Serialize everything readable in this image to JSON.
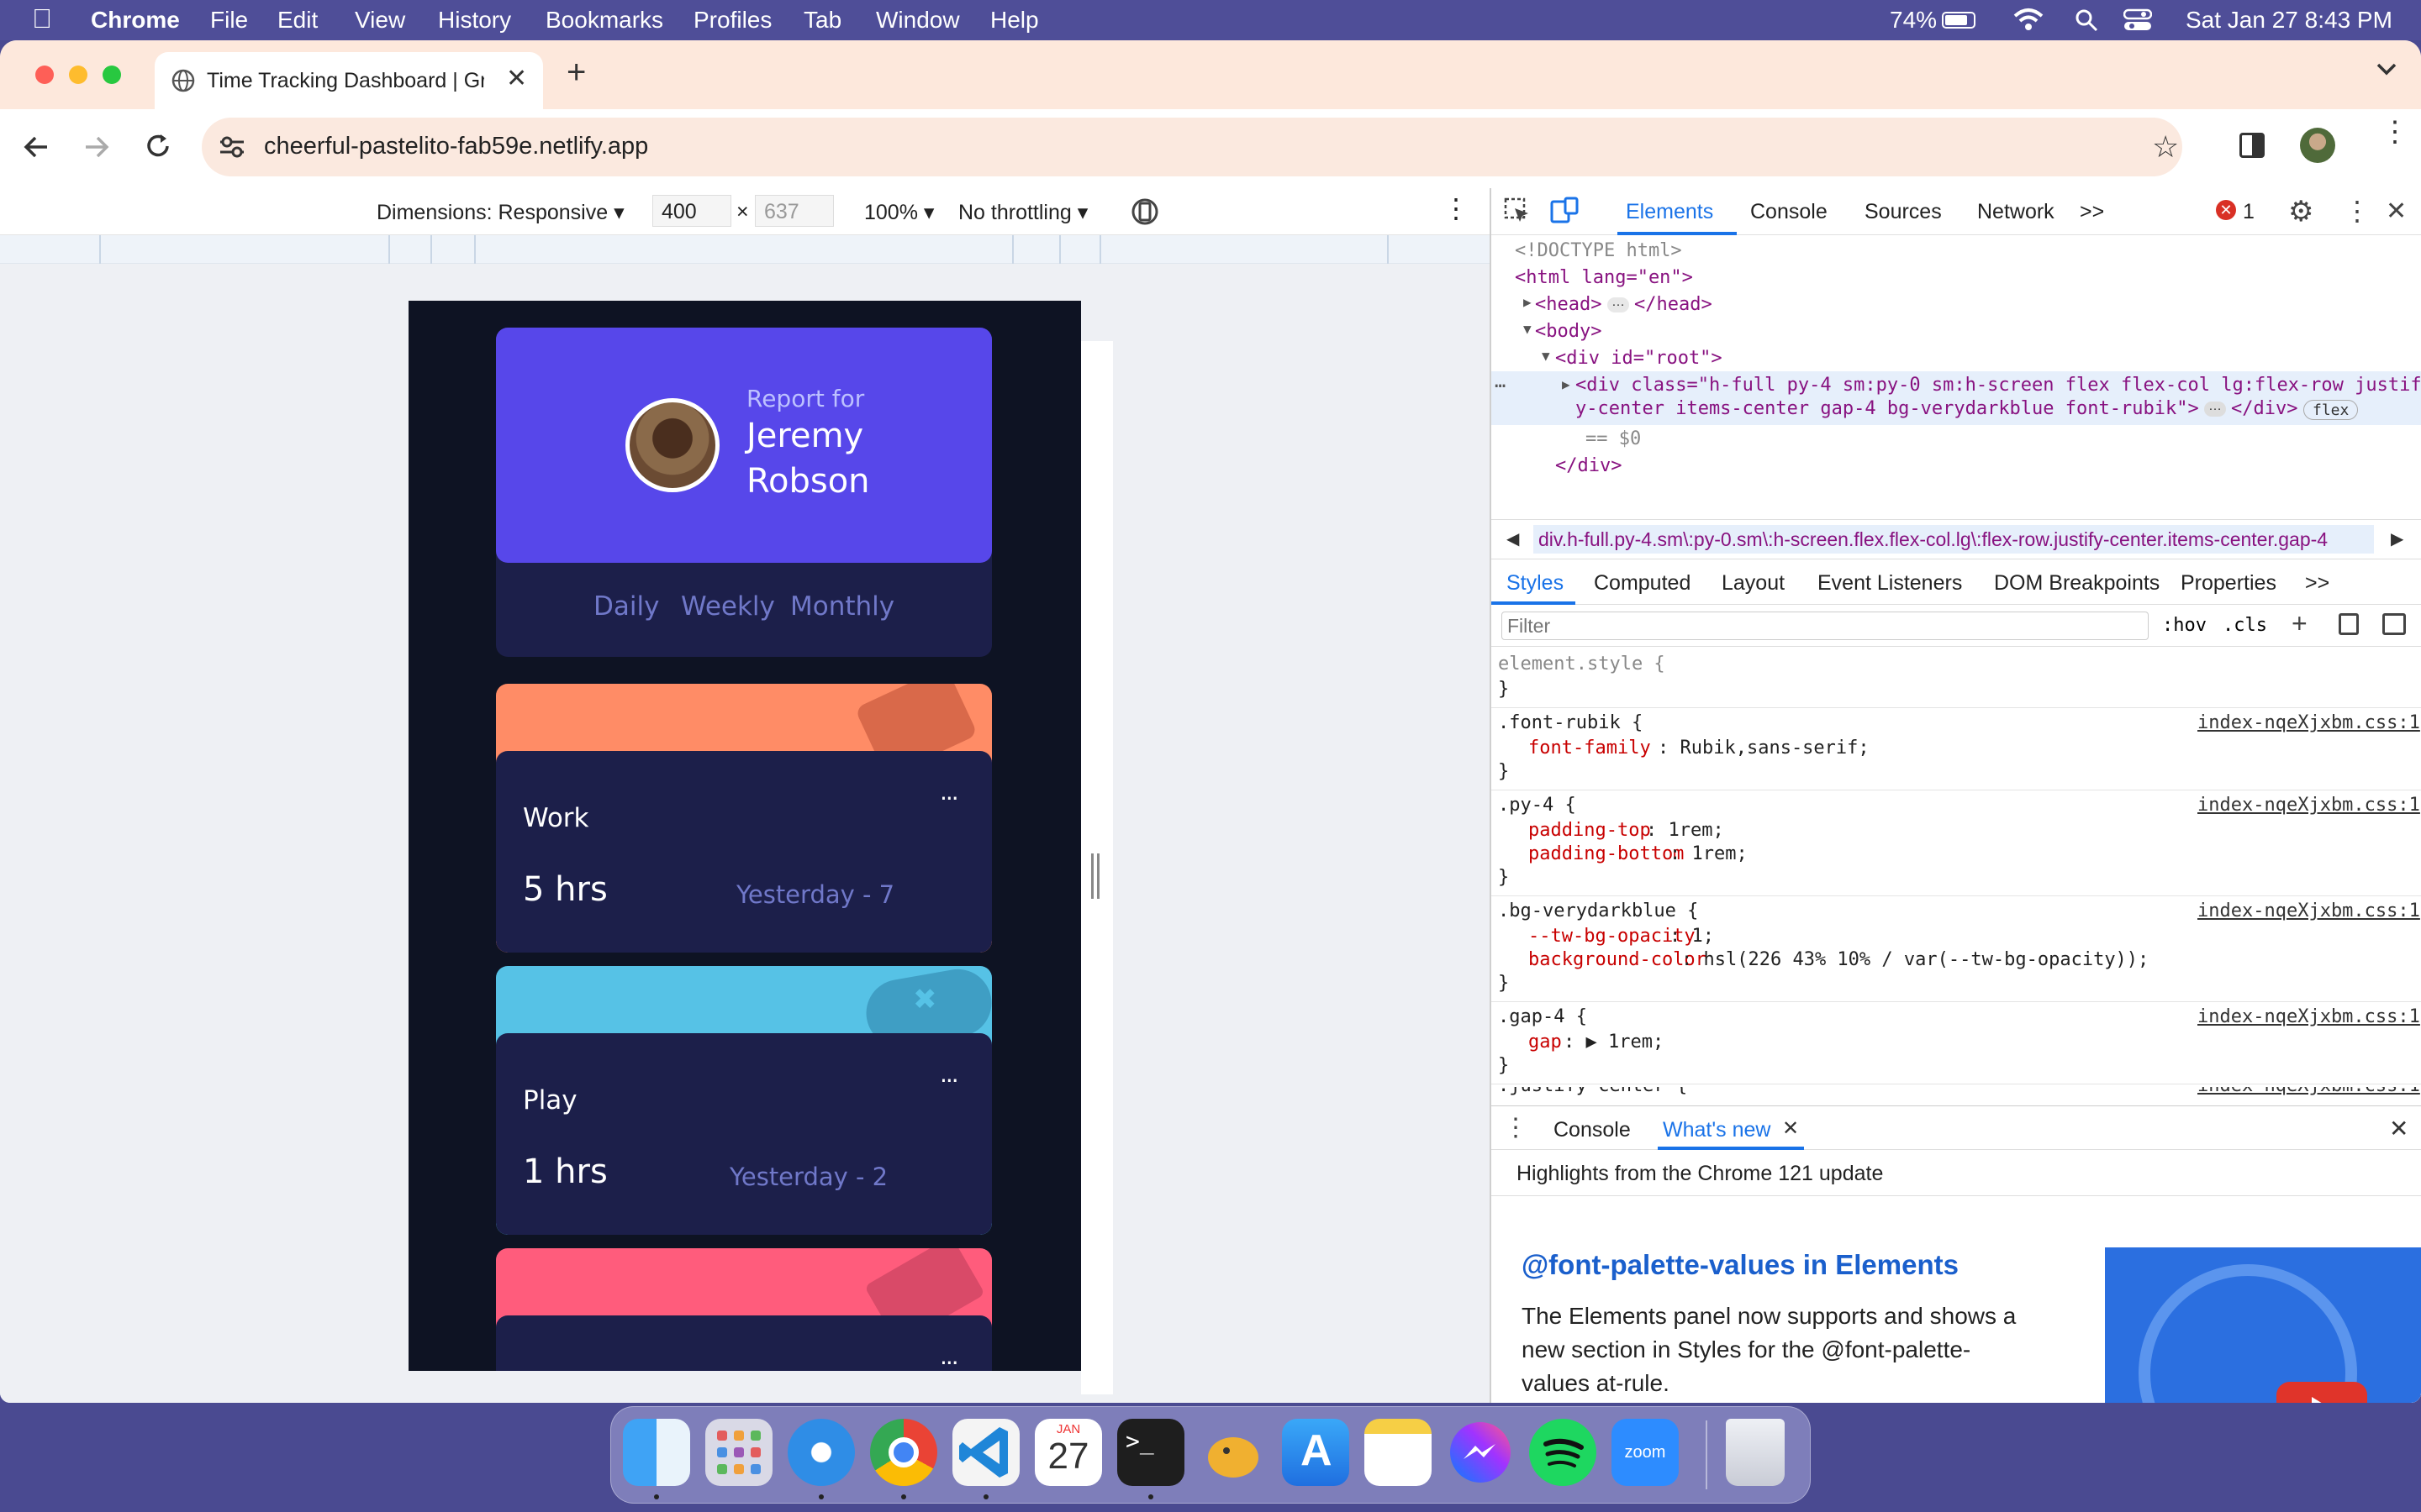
{
  "menubar": {
    "apple": "",
    "app_name": "Chrome",
    "items": [
      "File",
      "Edit",
      "View",
      "History",
      "Bookmarks",
      "Profiles",
      "Tab",
      "Window",
      "Help"
    ],
    "battery": "74%",
    "datetime": "Sat Jan 27  8:43 PM"
  },
  "browser": {
    "tab_title": "Time Tracking Dashboard | Gr",
    "new_tab": "+",
    "url": "cheerful-pastelito-fab59e.netlify.app"
  },
  "device_toolbar": {
    "dimensions_label": "Dimensions: Responsive",
    "width": "400",
    "times": "×",
    "height": "637",
    "zoom": "100%",
    "throttle": "No throttling"
  },
  "app": {
    "report_for": "Report for",
    "name_line1": "Jeremy",
    "name_line2": "Robson",
    "periods": [
      "Daily",
      "Weekly",
      "Monthly"
    ],
    "cards": [
      {
        "title": "Work",
        "hours": "5 hrs",
        "previous": "Yesterday - 7",
        "color": "#ff8c66"
      },
      {
        "title": "Play",
        "hours": "1 hrs",
        "previous": "Yesterday - 2",
        "color": "#56c2e6"
      },
      {
        "title": "",
        "hours": "",
        "previous": "",
        "color": "#ff5c7c"
      }
    ],
    "menu_dots": "···"
  },
  "devtools": {
    "tabs": [
      "Elements",
      "Console",
      "Sources",
      "Network"
    ],
    "more": ">>",
    "error_count": "1",
    "dom": {
      "doctype": "<!DOCTYPE html>",
      "html_open": "<html lang=\"en\">",
      "head": "<head>",
      "head_close": "</head>",
      "body": "<body>",
      "root": "<div id=\"root\">",
      "div_line1": "<div class=\"h-full py-4 sm:py-0 sm:h-screen flex flex-col lg:flex-row justif",
      "div_line2": "y-center items-center gap-4 bg-verydarkblue font-rubik\">",
      "div_close_inline": "</div>",
      "flex_badge": "flex",
      "eq0": "== $0",
      "div_close": "</div>"
    },
    "breadcrumb": "div.h-full.py-4.sm\\:py-0.sm\\:h-screen.flex.flex-col.lg\\:flex-row.justify-center.items-center.gap-4",
    "sub_tabs": [
      "Styles",
      "Computed",
      "Layout",
      "Event Listeners",
      "DOM Breakpoints",
      "Properties"
    ],
    "filter_placeholder": "Filter",
    "hov": ":hov",
    "cls": ".cls",
    "source": "index-nqeXjxbm.css:1",
    "rules": {
      "element_style": "element.style {",
      "close": "}",
      "font_rubik": ".font-rubik {",
      "font_family_prop": "font-family",
      "font_family_val": ": Rubik,sans-serif;",
      "py4": ".py-4 {",
      "pt_prop": "padding-top",
      "pt_val": ": 1rem;",
      "pb_prop": "padding-bottom",
      "pb_val": ": 1rem;",
      "bg": ".bg-verydarkblue {",
      "tw_prop": "--tw-bg-opacity",
      "tw_val": ": 1;",
      "bgc_prop": "background-color",
      "bgc_val": ": hsl(226 43% 10% / var(--tw-bg-opacity));",
      "gap": ".gap-4 {",
      "gap_prop": "gap",
      "gap_val": ": ▶ 1rem;",
      "justify": ".justify-center {"
    },
    "drawer_tabs": [
      "Console",
      "What's new"
    ],
    "highlights": "Highlights from the Chrome 121 update",
    "whats_new_title": "@font-palette-values in Elements",
    "whats_new_body": [
      "The Elements panel now supports and shows a",
      "new section in Styles for the @font-palette-",
      "values at-rule."
    ]
  },
  "dock": {
    "calendar_month": "JAN",
    "calendar_day": "27",
    "zoom_label": "zoom",
    "apps": [
      "Finder",
      "Launchpad",
      "Safari",
      "Chrome",
      "VS Code",
      "Calendar",
      "Terminal",
      "TablePlus",
      "App Store",
      "Notes",
      "Messenger",
      "Spotify",
      "Zoom",
      "Trash"
    ]
  }
}
